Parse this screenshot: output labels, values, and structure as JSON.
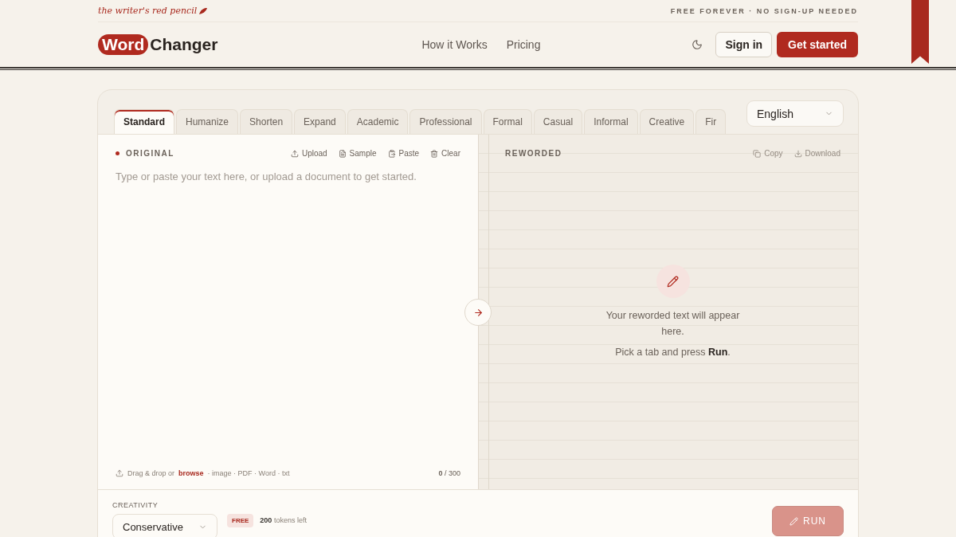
{
  "top_bar": {
    "tagline": "the writer's red pencil",
    "notice": "FREE FOREVER · NO SIGN-UP NEEDED"
  },
  "header": {
    "logo": {
      "highlight": "Word",
      "rest": "Changer"
    },
    "nav": [
      "How it Works",
      "Pricing"
    ],
    "sign_in": "Sign in",
    "get_started": "Get started"
  },
  "tabs": [
    {
      "label": "Standard",
      "selected": true
    },
    {
      "label": "Humanize",
      "selected": false
    },
    {
      "label": "Shorten",
      "selected": false
    },
    {
      "label": "Expand",
      "selected": false
    },
    {
      "label": "Academic",
      "selected": false
    },
    {
      "label": "Professional",
      "selected": false
    },
    {
      "label": "Formal",
      "selected": false
    },
    {
      "label": "Casual",
      "selected": false
    },
    {
      "label": "Informal",
      "selected": false
    },
    {
      "label": "Creative",
      "selected": false
    },
    {
      "label": "Fir",
      "selected": false
    }
  ],
  "language": "English",
  "original": {
    "title": "ORIGINAL",
    "actions": [
      {
        "kind": "upload",
        "label": "Upload"
      },
      {
        "kind": "sample",
        "label": "Sample"
      },
      {
        "kind": "paste",
        "label": "Paste"
      },
      {
        "kind": "clear",
        "label": "Clear"
      }
    ],
    "placeholder": "Type or paste your text here, or upload a document to get started.",
    "drop_hint": "Drag & drop or",
    "browse": "browse",
    "formats": "· image · PDF · Word · txt",
    "count": "**0** / 300"
  },
  "reworded": {
    "title": "REWORDED",
    "actions": [
      {
        "kind": "copy",
        "label": "Copy",
        "disabled": true
      },
      {
        "kind": "download",
        "label": "Download",
        "disabled": true
      }
    ],
    "message": "Your reworded text will appear here.",
    "hint": "Pick a tab and press **Run**."
  },
  "footer": {
    "creativity_label": "CREATIVITY",
    "creativity": "Conservative",
    "plan": "FREE",
    "tokens": "**200** tokens left",
    "run": {
      "label": "RUN",
      "disabled": true
    }
  }
}
